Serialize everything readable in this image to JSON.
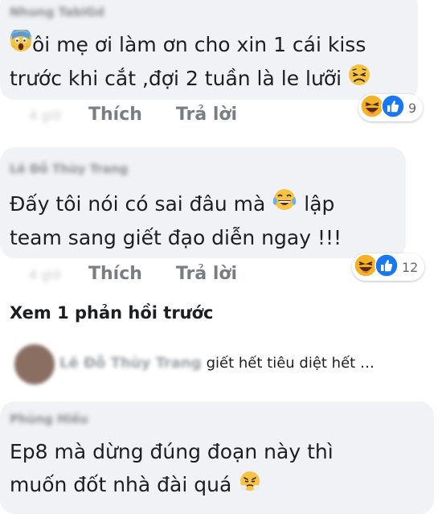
{
  "comments": [
    {
      "author": "Nhung TabiGd",
      "line1": "ôi mẹ ơi làm ơn cho xin 1 cái kiss",
      "line2": "trước khi cắt ,đợi 2 tuần là le lưỡi",
      "time": "4 giờ",
      "like_label": "Thích",
      "reply_label": "Trả lời",
      "reaction_count": "9",
      "emoji_start": "screaming-face-icon",
      "emoji_end": "weary-face-icon"
    },
    {
      "author": "Lê Đỗ Thùy Trang",
      "line1": "Đấy tôi nói có sai đâu mà",
      "line1_after": "lập",
      "line2": "team sang giết đạo diễn ngay !!!",
      "time": "4 giờ",
      "like_label": "Thích",
      "reply_label": "Trả lời",
      "reaction_count": "12",
      "emoji_inline": "tears-of-joy-icon"
    },
    {
      "author": "Phùng Hiếu",
      "line1": "Ep8 mà dừng đúng đoạn này thì",
      "line2": "muốn đốt nhà đài quá",
      "emoji_end": "steam-nose-face-icon"
    }
  ],
  "view_more": "Xem 1 phản hồi trước",
  "reply_preview": {
    "name": "Lê Đỗ Thùy Trang",
    "text": "giết hết tiêu diệt hết …"
  },
  "colors": {
    "bubble": "#f0f2f5",
    "like_blue": "#1877f2",
    "haha_yellow": "#f7b125",
    "meta_gray": "#7a7d82"
  }
}
